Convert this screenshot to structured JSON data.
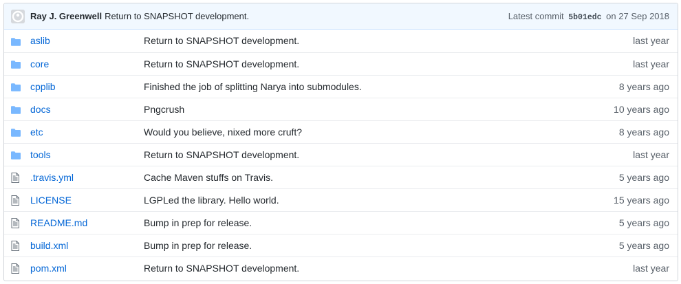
{
  "commit": {
    "author": "Ray J. Greenwell",
    "message": "Return to SNAPSHOT development.",
    "latest_label": "Latest commit",
    "sha": "5b01edc",
    "on_label": "on",
    "date": "27 Sep 2018"
  },
  "files": [
    {
      "type": "folder",
      "name": "aslib",
      "message": "Return to SNAPSHOT development.",
      "age": "last year"
    },
    {
      "type": "folder",
      "name": "core",
      "message": "Return to SNAPSHOT development.",
      "age": "last year"
    },
    {
      "type": "folder",
      "name": "cpplib",
      "message": "Finished the job of splitting Narya into submodules.",
      "age": "8 years ago"
    },
    {
      "type": "folder",
      "name": "docs",
      "message": "Pngcrush",
      "age": "10 years ago"
    },
    {
      "type": "folder",
      "name": "etc",
      "message": "Would you believe, nixed more cruft?",
      "age": "8 years ago"
    },
    {
      "type": "folder",
      "name": "tools",
      "message": "Return to SNAPSHOT development.",
      "age": "last year"
    },
    {
      "type": "file",
      "name": ".travis.yml",
      "message": "Cache Maven stuffs on Travis.",
      "age": "5 years ago"
    },
    {
      "type": "file",
      "name": "LICENSE",
      "message": "LGPLed the library. Hello world.",
      "age": "15 years ago"
    },
    {
      "type": "file",
      "name": "README.md",
      "message": "Bump in prep for release.",
      "age": "5 years ago"
    },
    {
      "type": "file",
      "name": "build.xml",
      "message": "Bump in prep for release.",
      "age": "5 years ago"
    },
    {
      "type": "file",
      "name": "pom.xml",
      "message": "Return to SNAPSHOT development.",
      "age": "last year"
    }
  ],
  "icons": {
    "folder": "folder-icon",
    "file": "file-icon"
  },
  "colors": {
    "link": "#0366d6",
    "icon": "#79b8ff",
    "folder_icon": "#79b8ff",
    "header_bg": "#f1f8ff"
  }
}
